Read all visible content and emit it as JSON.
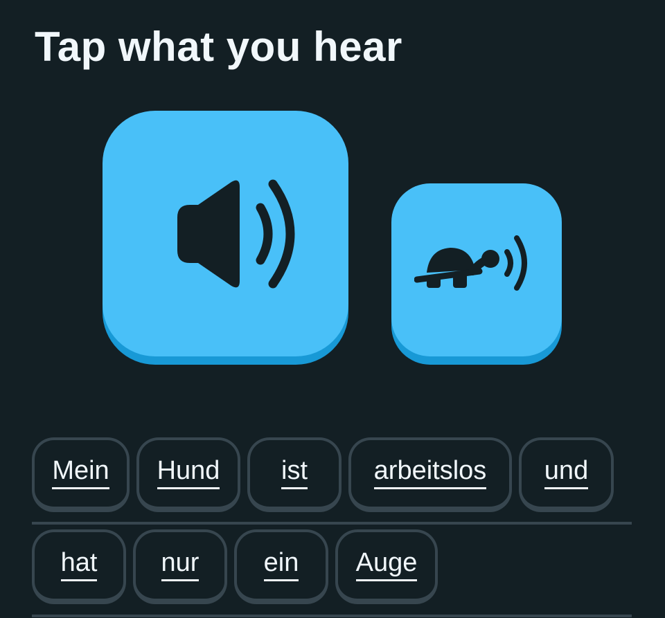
{
  "header": {
    "title": "Tap what you hear"
  },
  "audio": {
    "normal_icon": "speaker-icon",
    "slow_icon": "turtle-speaker-icon",
    "button_color": "#49c0f8",
    "button_shadow_color": "#1899d6"
  },
  "word_bank": {
    "row1": [
      "Mein",
      "Hund",
      "ist",
      "arbeitslos",
      "und"
    ],
    "row2": [
      "hat",
      "nur",
      "ein",
      "Auge"
    ]
  },
  "colors": {
    "background": "#131f24",
    "chip_border": "#37464f",
    "text": "#f1f7fb"
  }
}
